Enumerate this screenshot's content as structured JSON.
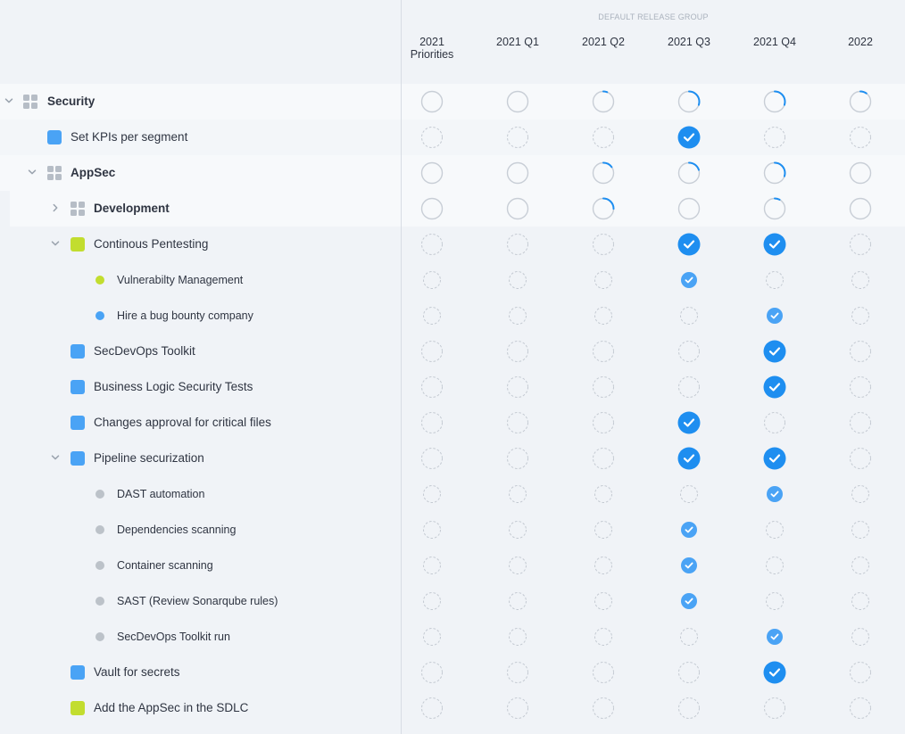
{
  "colors": {
    "accent": "#1e8ef0",
    "blue_item": "#4aa3f5",
    "green_item": "#c2dd2f",
    "gray_item": "#bcc2c9"
  },
  "header": {
    "release_group": "DEFAULT RELEASE GROUP",
    "columns": [
      {
        "line1": "2021",
        "line2": "Priorities"
      },
      {
        "line1": "2021 Q1",
        "line2": ""
      },
      {
        "line1": "2021 Q2",
        "line2": ""
      },
      {
        "line1": "2021 Q3",
        "line2": ""
      },
      {
        "line1": "2021 Q4",
        "line2": ""
      },
      {
        "line1": "2022",
        "line2": ""
      }
    ]
  },
  "rows": [
    {
      "label": "Security",
      "kind": "group",
      "level": 0,
      "chevron": "down",
      "bold": true,
      "cells": [
        {
          "t": "empty"
        },
        {
          "t": "empty"
        },
        {
          "t": "progress",
          "p": 0.06
        },
        {
          "t": "progress",
          "p": 0.3
        },
        {
          "t": "progress",
          "p": 0.3
        },
        {
          "t": "progress",
          "p": 0.1
        }
      ]
    },
    {
      "label": "Set KPIs per segment",
      "kind": "item",
      "color": "blue",
      "level": 1,
      "cells": [
        {
          "t": "dashed"
        },
        {
          "t": "dashed"
        },
        {
          "t": "dashed"
        },
        {
          "t": "check"
        },
        {
          "t": "dashed"
        },
        {
          "t": "dashed"
        }
      ]
    },
    {
      "label": "AppSec",
      "kind": "group",
      "level": 1,
      "chevron": "down",
      "bold": true,
      "cells": [
        {
          "t": "empty"
        },
        {
          "t": "empty"
        },
        {
          "t": "progress",
          "p": 0.15
        },
        {
          "t": "progress",
          "p": 0.2
        },
        {
          "t": "progress",
          "p": 0.3
        },
        {
          "t": "empty"
        }
      ]
    },
    {
      "label": "Development",
      "kind": "group",
      "level": 2,
      "chevron": "right",
      "bold": true,
      "cells": [
        {
          "t": "empty"
        },
        {
          "t": "empty"
        },
        {
          "t": "progress",
          "p": 0.25
        },
        {
          "t": "empty"
        },
        {
          "t": "progress",
          "p": 0.08
        },
        {
          "t": "empty"
        }
      ]
    },
    {
      "label": "Continous Pentesting",
      "kind": "item",
      "color": "green",
      "level": 2,
      "chevron": "down",
      "cells": [
        {
          "t": "dashed"
        },
        {
          "t": "dashed"
        },
        {
          "t": "dashed"
        },
        {
          "t": "check"
        },
        {
          "t": "check"
        },
        {
          "t": "dashed"
        }
      ]
    },
    {
      "label": "Vulnerabilty Management",
      "kind": "sub",
      "color": "green",
      "level": 3,
      "cells": [
        {
          "t": "sdashed"
        },
        {
          "t": "sdashed"
        },
        {
          "t": "sdashed"
        },
        {
          "t": "scheck"
        },
        {
          "t": "sdashed"
        },
        {
          "t": "sdashed"
        }
      ]
    },
    {
      "label": "Hire a bug bounty company",
      "kind": "sub",
      "color": "blue",
      "level": 3,
      "cells": [
        {
          "t": "sdashed"
        },
        {
          "t": "sdashed"
        },
        {
          "t": "sdashed"
        },
        {
          "t": "sdashed"
        },
        {
          "t": "scheck"
        },
        {
          "t": "sdashed"
        }
      ]
    },
    {
      "label": "SecDevOps Toolkit",
      "kind": "item",
      "color": "blue",
      "level": 2,
      "cells": [
        {
          "t": "dashed"
        },
        {
          "t": "dashed"
        },
        {
          "t": "dashed"
        },
        {
          "t": "dashed"
        },
        {
          "t": "check"
        },
        {
          "t": "dashed"
        }
      ]
    },
    {
      "label": "Business Logic Security Tests",
      "kind": "item",
      "color": "blue",
      "level": 2,
      "cells": [
        {
          "t": "dashed"
        },
        {
          "t": "dashed"
        },
        {
          "t": "dashed"
        },
        {
          "t": "dashed"
        },
        {
          "t": "check"
        },
        {
          "t": "dashed"
        }
      ]
    },
    {
      "label": "Changes approval for critical files",
      "kind": "item",
      "color": "blue",
      "level": 2,
      "cells": [
        {
          "t": "dashed"
        },
        {
          "t": "dashed"
        },
        {
          "t": "dashed"
        },
        {
          "t": "check"
        },
        {
          "t": "dashed"
        },
        {
          "t": "dashed"
        }
      ]
    },
    {
      "label": "Pipeline securization",
      "kind": "item",
      "color": "blue",
      "level": 2,
      "chevron": "down",
      "cells": [
        {
          "t": "dashed"
        },
        {
          "t": "dashed"
        },
        {
          "t": "dashed"
        },
        {
          "t": "check"
        },
        {
          "t": "check"
        },
        {
          "t": "dashed"
        }
      ]
    },
    {
      "label": "DAST automation",
      "kind": "sub",
      "color": "gray",
      "level": 3,
      "cells": [
        {
          "t": "sdashed"
        },
        {
          "t": "sdashed"
        },
        {
          "t": "sdashed"
        },
        {
          "t": "sdashed"
        },
        {
          "t": "scheck"
        },
        {
          "t": "sdashed"
        }
      ]
    },
    {
      "label": "Dependencies scanning",
      "kind": "sub",
      "color": "gray",
      "level": 3,
      "cells": [
        {
          "t": "sdashed"
        },
        {
          "t": "sdashed"
        },
        {
          "t": "sdashed"
        },
        {
          "t": "scheck"
        },
        {
          "t": "sdashed"
        },
        {
          "t": "sdashed"
        }
      ]
    },
    {
      "label": "Container scanning",
      "kind": "sub",
      "color": "gray",
      "level": 3,
      "cells": [
        {
          "t": "sdashed"
        },
        {
          "t": "sdashed"
        },
        {
          "t": "sdashed"
        },
        {
          "t": "scheck"
        },
        {
          "t": "sdashed"
        },
        {
          "t": "sdashed"
        }
      ]
    },
    {
      "label": "SAST (Review Sonarqube rules)",
      "kind": "sub",
      "color": "gray",
      "level": 3,
      "cells": [
        {
          "t": "sdashed"
        },
        {
          "t": "sdashed"
        },
        {
          "t": "sdashed"
        },
        {
          "t": "scheck"
        },
        {
          "t": "sdashed"
        },
        {
          "t": "sdashed"
        }
      ]
    },
    {
      "label": "SecDevOps Toolkit run",
      "kind": "sub",
      "color": "gray",
      "level": 3,
      "cells": [
        {
          "t": "sdashed"
        },
        {
          "t": "sdashed"
        },
        {
          "t": "sdashed"
        },
        {
          "t": "sdashed"
        },
        {
          "t": "scheck"
        },
        {
          "t": "sdashed"
        }
      ]
    },
    {
      "label": "Vault for secrets",
      "kind": "item",
      "color": "blue",
      "level": 2,
      "cells": [
        {
          "t": "dashed"
        },
        {
          "t": "dashed"
        },
        {
          "t": "dashed"
        },
        {
          "t": "dashed"
        },
        {
          "t": "check"
        },
        {
          "t": "dashed"
        }
      ]
    },
    {
      "label": "Add the AppSec in the SDLC",
      "kind": "item",
      "color": "green",
      "level": 2,
      "cells": [
        {
          "t": "dashed"
        },
        {
          "t": "dashed"
        },
        {
          "t": "dashed"
        },
        {
          "t": "dashed"
        },
        {
          "t": "dashed"
        },
        {
          "t": "dashed"
        }
      ]
    }
  ]
}
